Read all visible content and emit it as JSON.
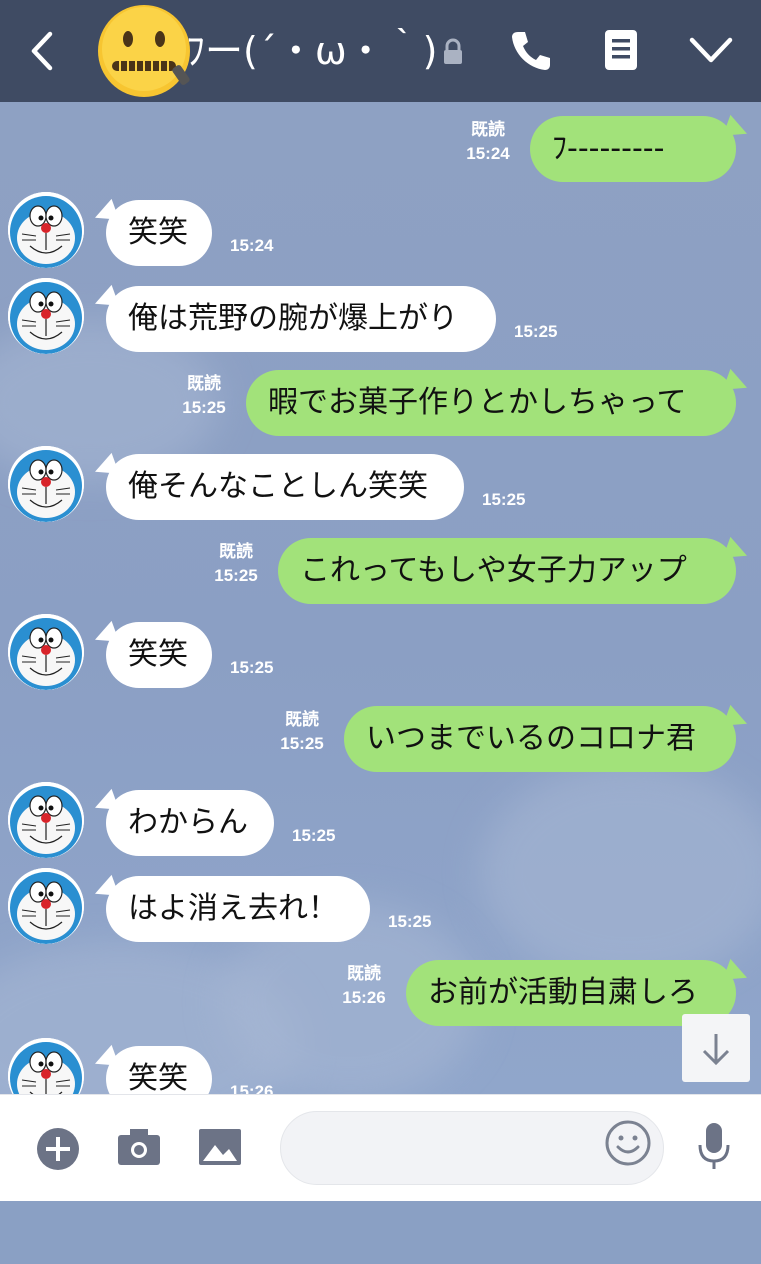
{
  "header": {
    "title": "ﾌー(´・ω・｀)",
    "icons": [
      "back-icon",
      "lock-icon",
      "phone-icon",
      "notes-icon",
      "chevron-down-icon"
    ],
    "bar_color": "#3f4b63"
  },
  "messages": [
    {
      "side": "out",
      "text": "ﾌ---------",
      "read": "既読",
      "time": "15:24"
    },
    {
      "side": "in",
      "text": "笑笑",
      "time": "15:24"
    },
    {
      "side": "in",
      "text": "俺は荒野の腕が爆上がり",
      "time": "15:25"
    },
    {
      "side": "out",
      "text": "暇でお菓子作りとかしちゃって",
      "read": "既読",
      "time": "15:25"
    },
    {
      "side": "in",
      "text": "俺そんなことしん笑笑",
      "time": "15:25"
    },
    {
      "side": "out",
      "text": "これってもしや女子力アップ",
      "read": "既読",
      "time": "15:25"
    },
    {
      "side": "in",
      "text": "笑笑",
      "time": "15:25"
    },
    {
      "side": "out",
      "text": "いつまでいるのコロナ君",
      "read": "既読",
      "time": "15:25"
    },
    {
      "side": "in",
      "text": "わからん",
      "time": "15:25"
    },
    {
      "side": "in",
      "text": "はよ消え去れ！",
      "time": "15:25"
    },
    {
      "side": "out",
      "text": "お前が活動自粛しろ",
      "read": "既読",
      "time": "15:26"
    },
    {
      "side": "in",
      "text": "笑笑",
      "time": "15:26"
    }
  ],
  "input": {
    "placeholder": "",
    "icons": [
      "add-icon",
      "camera-icon",
      "image-icon",
      "emoji-icon",
      "microphone-icon"
    ]
  },
  "colors": {
    "outgoing": "#a2e27a",
    "incoming": "#ffffff",
    "background": "#8ea1c3"
  }
}
